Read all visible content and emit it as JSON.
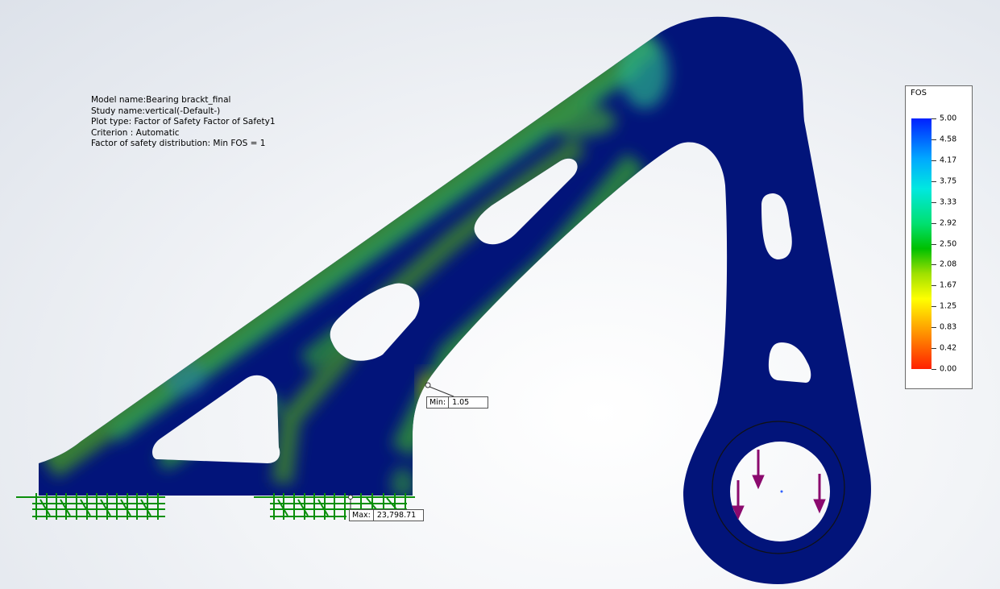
{
  "info": {
    "model_name": "Model name:Bearing brackt_final",
    "study_name": "Study name:vertical(-Default-)",
    "plot_type": "Plot type: Factor of Safety Factor of Safety1",
    "criterion": "Criterion : Automatic",
    "distribution": "Factor of safety distribution: Min FOS = 1"
  },
  "legend": {
    "title": "FOS",
    "values": [
      "5.00",
      "4.58",
      "4.17",
      "3.75",
      "3.33",
      "2.92",
      "2.50",
      "2.08",
      "1.67",
      "1.25",
      "0.83",
      "0.42",
      "0.00"
    ],
    "colors": {
      "high": "#0020ff",
      "mid": "#00c000",
      "low": "#ff2000"
    }
  },
  "probes": {
    "min": {
      "label": "Min:",
      "value": "1.05"
    },
    "max": {
      "label": "Max:",
      "value": "23,798.71"
    }
  },
  "colors": {
    "part_base": "#02147a",
    "green": "#1f8c3a",
    "fixture": "#0a8f0a",
    "load_arrow": "#8b0a6e"
  }
}
